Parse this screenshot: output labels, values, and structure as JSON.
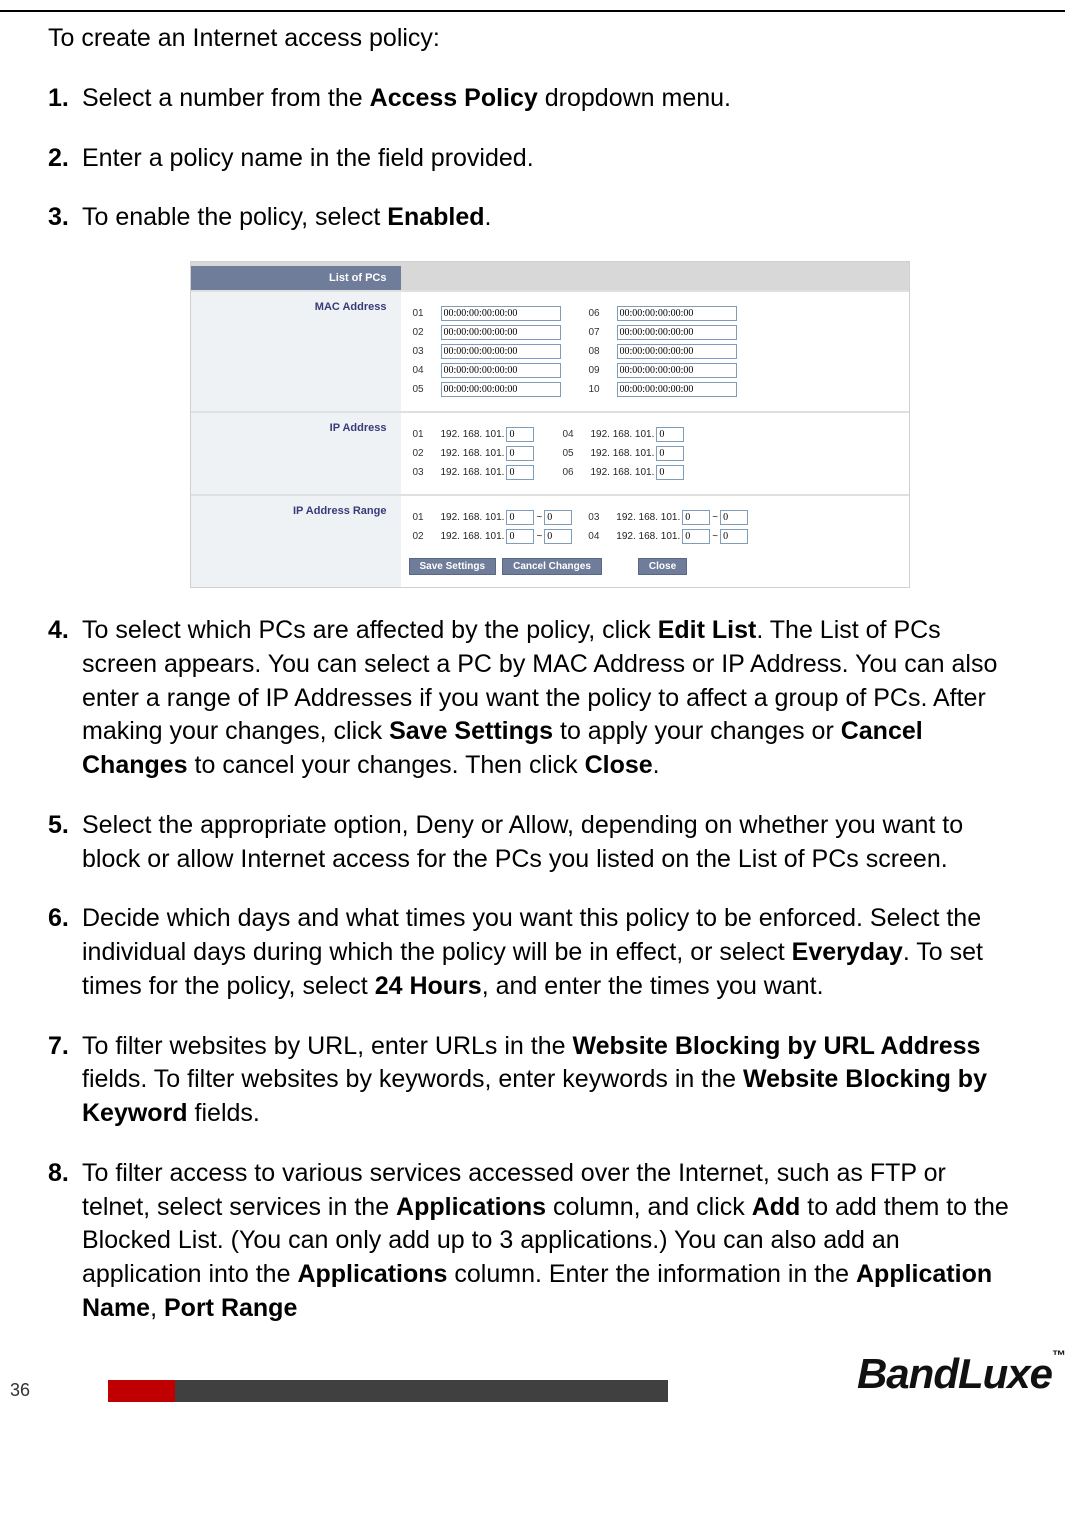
{
  "intro": "To create an Internet access policy:",
  "steps": {
    "s1_a": "Select a number from the ",
    "s1_b": "Access Policy",
    "s1_c": " dropdown menu.",
    "s2": "Enter a policy name in the field provided.",
    "s3_a": "To enable the policy, select ",
    "s3_b": "Enabled",
    "s3_c": ".",
    "s4_a": "To select which PCs are affected by the policy, click ",
    "s4_b": "Edit List",
    "s4_c": ". The List of PCs screen appears. You can select a PC by MAC Address or IP Address. You can also enter a range of IP Addresses if you want the policy to affect a group of PCs. After making your changes, click ",
    "s4_d": "Save Settings",
    "s4_e": " to apply your changes or ",
    "s4_f": "Cancel Changes",
    "s4_g": " to cancel your changes. Then click ",
    "s4_h": "Close",
    "s4_i": ".",
    "s5": "Select the appropriate option, Deny or Allow, depending on whether you want to block or allow Internet access for the PCs you listed on the List of PCs screen.",
    "s6_a": "Decide which days and what times you want this policy to be enforced. Select the individual days during which the policy will be in effect, or select ",
    "s6_b": "Everyday",
    "s6_c": ". To set times for the policy, select ",
    "s6_d": "24 Hours",
    "s6_e": ", and enter the times you want.",
    "s7_a": "To filter websites by URL, enter URLs in the ",
    "s7_b": "Website Blocking by URL Address",
    "s7_c": " fields. To filter websites by keywords, enter keywords in the ",
    "s7_d": "Website Blocking by Keyword",
    "s7_e": " fields.",
    "s8_a": "To filter access to various services accessed over the Internet, such as FTP or telnet, select services in the ",
    "s8_b": "Applications",
    "s8_c": " column, and click ",
    "s8_d": "Add",
    "s8_e": " to add them to the Blocked List. (You can only add up to 3 applications.) You can also add an application into the ",
    "s8_f": "Applications",
    "s8_g": " column. Enter the information in the ",
    "s8_h": "Application Name",
    "s8_i": ", ",
    "s8_j": "Port Range"
  },
  "panel": {
    "header": "List of PCs",
    "mac_label": "MAC Address",
    "ip_label": "IP Address",
    "range_label": "IP Address Range",
    "mac_rows_left": [
      {
        "idx": "01",
        "val": "00:00:00:00:00:00"
      },
      {
        "idx": "02",
        "val": "00:00:00:00:00:00"
      },
      {
        "idx": "03",
        "val": "00:00:00:00:00:00"
      },
      {
        "idx": "04",
        "val": "00:00:00:00:00:00"
      },
      {
        "idx": "05",
        "val": "00:00:00:00:00:00"
      }
    ],
    "mac_rows_right": [
      {
        "idx": "06",
        "val": "00:00:00:00:00:00"
      },
      {
        "idx": "07",
        "val": "00:00:00:00:00:00"
      },
      {
        "idx": "08",
        "val": "00:00:00:00:00:00"
      },
      {
        "idx": "09",
        "val": "00:00:00:00:00:00"
      },
      {
        "idx": "10",
        "val": "00:00:00:00:00:00"
      }
    ],
    "ip_prefix": "192. 168. 101.",
    "ip_rows_left": [
      {
        "idx": "01",
        "val": "0"
      },
      {
        "idx": "02",
        "val": "0"
      },
      {
        "idx": "03",
        "val": "0"
      }
    ],
    "ip_rows_right": [
      {
        "idx": "04",
        "val": "0"
      },
      {
        "idx": "05",
        "val": "0"
      },
      {
        "idx": "06",
        "val": "0"
      }
    ],
    "range_prefix": "192. 168. 101.",
    "tilde": "~",
    "range_rows_left": [
      {
        "idx": "01",
        "a": "0",
        "b": "0"
      },
      {
        "idx": "02",
        "a": "0",
        "b": "0"
      }
    ],
    "range_rows_right": [
      {
        "idx": "03",
        "a": "0",
        "b": "0"
      },
      {
        "idx": "04",
        "a": "0",
        "b": "0"
      }
    ],
    "buttons": {
      "save": "Save Settings",
      "cancel": "Cancel Changes",
      "close": "Close"
    }
  },
  "footer": {
    "page_number": "36",
    "brand": "BandLuxe",
    "tm": "™"
  }
}
